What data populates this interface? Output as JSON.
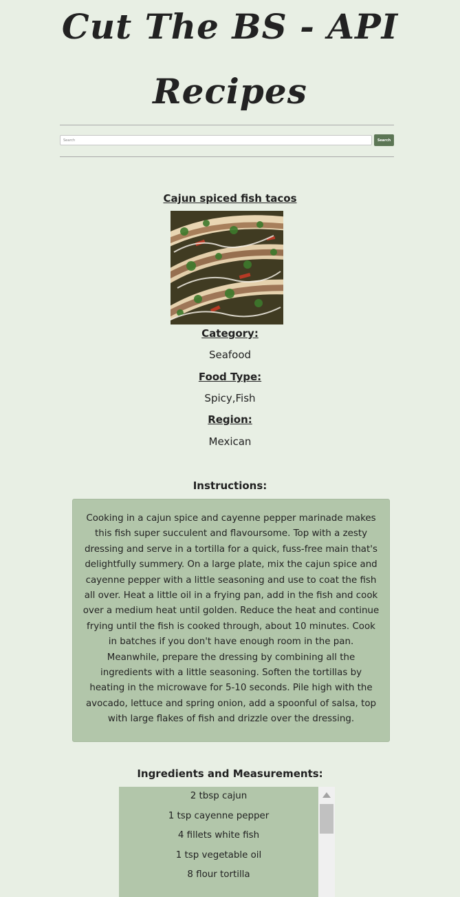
{
  "site": {
    "title_line1": "Cut The BS - API",
    "title_line2": "Recipes"
  },
  "search": {
    "placeholder": "Search",
    "value": "",
    "button_label": "Search"
  },
  "recipe": {
    "name": "Cajun spiced fish tacos",
    "category_label": "Category:",
    "category": "Seafood",
    "food_type_label": "Food Type:",
    "food_type": "Spicy,Fish",
    "region_label": "Region:",
    "region": "Mexican",
    "instructions_label": "Instructions:",
    "instructions": "Cooking in a cajun spice and cayenne pepper marinade makes this fish super succulent and flavoursome. Top with a zesty dressing and serve in a tortilla for a quick, fuss-free main that's delightfully summery. On a large plate, mix the cajun spice and cayenne pepper with a little seasoning and use to coat the fish all over. Heat a little oil in a frying pan, add in the fish and cook over a medium heat until golden. Reduce the heat and continue frying until the fish is cooked through, about 10 minutes. Cook in batches if you don't have enough room in the pan. Meanwhile, prepare the dressing by combining all the ingredients with a little seasoning. Soften the tortillas by heating in the microwave for 5-10 seconds. Pile high with the avocado, lettuce and spring onion, add a spoonful of salsa, top with large flakes of fish and drizzle over the dressing.",
    "ingredients_label": "Ingredients and Measurements:",
    "ingredients": [
      "2 tbsp cajun",
      "1 tsp cayenne pepper",
      "4 fillets white fish",
      "1 tsp vegetable oil",
      "8 flour tortilla"
    ]
  },
  "colors": {
    "page_background": "#e8efe4",
    "panel_background": "#b2c6aa",
    "search_button": "#5c7655",
    "text": "#212121"
  },
  "icons": {
    "scroll_up": "triangle-up"
  }
}
